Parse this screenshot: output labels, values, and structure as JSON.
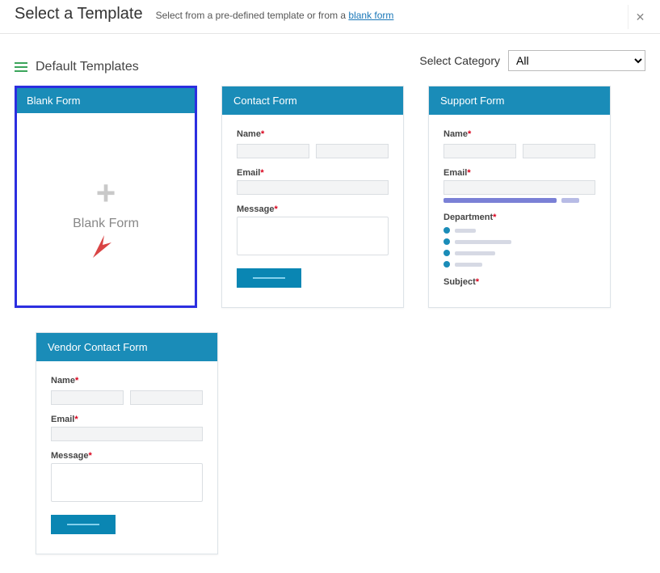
{
  "header": {
    "title": "Select a Template",
    "subtitle_prefix": "Select from a pre-defined template or from a ",
    "subtitle_link": "blank form"
  },
  "category": {
    "label": "Select Category",
    "selected": "All"
  },
  "section": {
    "heading": "Default Templates"
  },
  "cards": {
    "blank": {
      "header": "Blank Form",
      "body_label": "Blank Form"
    },
    "contact": {
      "header": "Contact Form",
      "fields": {
        "name": "Name",
        "email": "Email",
        "message": "Message"
      }
    },
    "support": {
      "header": "Support Form",
      "fields": {
        "name": "Name",
        "email": "Email",
        "department": "Department",
        "subject": "Subject"
      }
    },
    "vendor": {
      "header": "Vendor Contact Form",
      "fields": {
        "name": "Name",
        "email": "Email",
        "message": "Message"
      }
    }
  }
}
